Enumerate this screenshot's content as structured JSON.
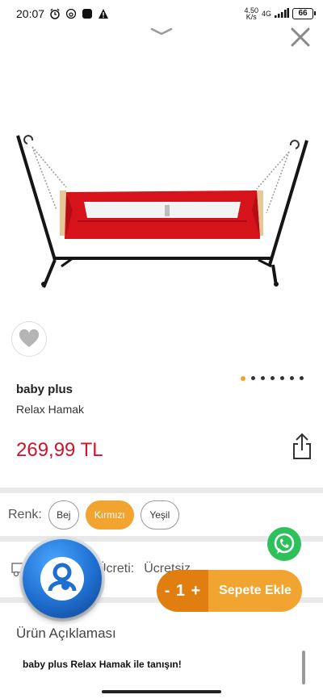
{
  "status_bar": {
    "time": "20:07",
    "network_speed_top": "4.50",
    "network_speed_bottom": "K/s",
    "signal": "4G",
    "battery": "66",
    "icons": [
      "alarm-icon",
      "mobile-data-icon",
      "app-notification-icon",
      "warning-icon"
    ]
  },
  "header": {
    "close_icon": "close-icon",
    "handle_icon": "chevron-down-icon"
  },
  "product": {
    "brand": "baby plus",
    "name": "Relax Hamak",
    "price": "269,99 TL",
    "image_alt": "red hammock crib with black stand",
    "image_count": 7,
    "active_image_index": 0
  },
  "color_selector": {
    "label": "Renk:",
    "options": [
      "Bej",
      "Kırmızı",
      "Yeşil"
    ],
    "selected": "Kırmızı"
  },
  "shipping": {
    "label_fragment": "Ücreti:",
    "value": "Ücretsiz"
  },
  "cart": {
    "minus": "-",
    "quantity": "1",
    "plus": "+",
    "add_label": "Sepete Ekle"
  },
  "description": {
    "title": "Ürün Açıklaması",
    "intro": "baby plus Relax Hamak ile tanışın!"
  },
  "colors": {
    "accent": "#f2a430",
    "accent_dark": "#e07e10",
    "price": "#d0142c",
    "whatsapp": "#2ec05a"
  }
}
